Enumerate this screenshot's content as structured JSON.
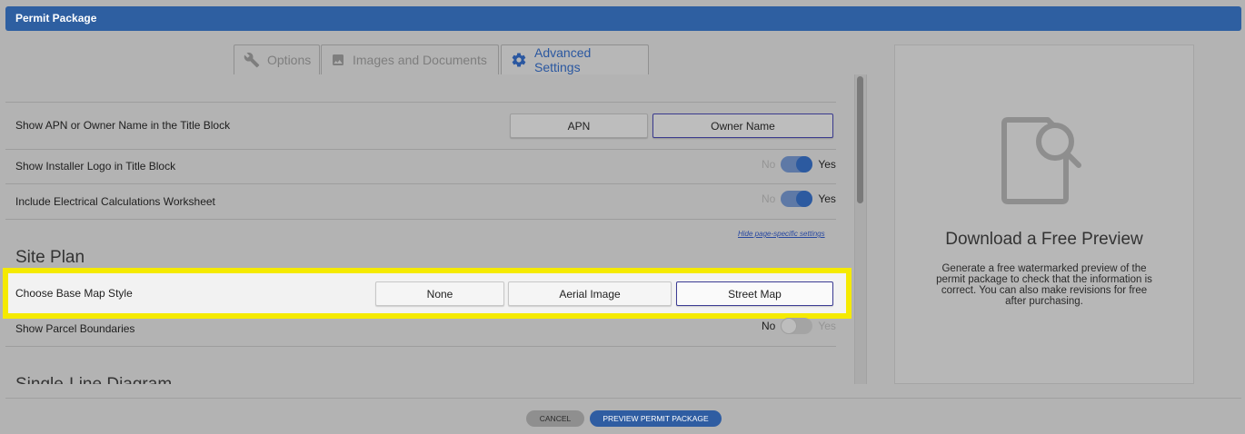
{
  "header": {
    "title": "Permit Package"
  },
  "tabs": [
    {
      "label": "Options",
      "icon": "wrench-icon",
      "active": false
    },
    {
      "label": "Images and Documents",
      "icon": "image-icon",
      "active": false
    },
    {
      "label": "Advanced Settings",
      "icon": "gear-icon",
      "active": true
    }
  ],
  "settings": {
    "apn_owner": {
      "label": "Show APN or Owner Name in the Title Block",
      "options": [
        "APN",
        "Owner Name"
      ],
      "selected": "Owner Name"
    },
    "installer_logo": {
      "label": "Show Installer Logo in Title Block",
      "no": "No",
      "yes": "Yes",
      "value": true
    },
    "elec_calc": {
      "label": "Include Electrical Calculations Worksheet",
      "no": "No",
      "yes": "Yes",
      "value": true
    },
    "hide_link": "Hide page-specific settings"
  },
  "site_plan": {
    "title": "Site Plan",
    "base_map": {
      "label": "Choose Base Map Style",
      "options": [
        "None",
        "Aerial Image",
        "Street Map"
      ],
      "selected": "Street Map"
    },
    "parcel": {
      "label": "Show Parcel Boundaries",
      "no": "No",
      "yes": "Yes",
      "value": false
    }
  },
  "single_line": {
    "title": "Single-Line Diagram"
  },
  "preview": {
    "title": "Download a Free Preview",
    "text": "Generate a free watermarked preview of the permit package to check that the information is correct. You can also make revisions for free after purchasing."
  },
  "footer": {
    "cancel": "CANCEL",
    "preview": "PREVIEW PERMIT PACKAGE"
  },
  "colors": {
    "accent": "#2e5fa1",
    "highlight": "#f5ea00"
  }
}
